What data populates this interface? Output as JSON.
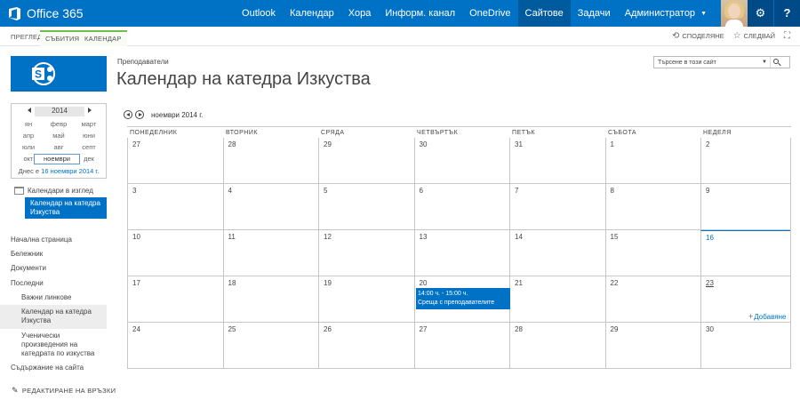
{
  "suite": {
    "brand": "Office 365",
    "nav": [
      {
        "label": "Outlook"
      },
      {
        "label": "Календар"
      },
      {
        "label": "Хора"
      },
      {
        "label": "Информ. канал"
      },
      {
        "label": "OneDrive"
      },
      {
        "label": "Сайтове",
        "active": true
      },
      {
        "label": "Задачи"
      },
      {
        "label": "Администратор",
        "dropdown": true
      }
    ],
    "help_label": "?"
  },
  "ribbon": {
    "tabs": [
      "ПРЕГЛЕД",
      "СЪБИТИЯ",
      "КАЛЕНДАР"
    ],
    "share_label": "СПОДЕЛЯНЕ",
    "follow_label": "СЛЕДВАЙ"
  },
  "datepicker": {
    "year": "2014",
    "months": [
      "ян",
      "февр",
      "март",
      "апр",
      "май",
      "юни",
      "юли",
      "авг",
      "септ",
      "окт",
      "ноември",
      "дек"
    ],
    "selected_month": "ноември",
    "today_prefix": "Днес е ",
    "today_link": "16 ноември 2014 г."
  },
  "calendars_in_view": {
    "header": "Календари в изглед",
    "item": "Календар на катедра Изкуства"
  },
  "quicknav": {
    "home": "Начална страница",
    "notebook": "Бележник",
    "documents": "Документи",
    "recent": "Последни",
    "recent_items": [
      "Важни линкове",
      "Календар на катедра Изкуства",
      "Ученически произведения на катедрата по изкуства"
    ],
    "site_contents": "Съдържание на сайта",
    "edit_links": "РЕДАКТИРАНЕ НА ВРЪЗКИ"
  },
  "header": {
    "breadcrumb": "Преподаватели",
    "title": "Календар на катедра Изкуства",
    "search_placeholder": "Търсене в този сайт"
  },
  "calendar": {
    "month_label": "ноември 2014 г.",
    "weekdays": [
      "ПОНЕДЕЛНИК",
      "ВТОРНИК",
      "СРЯДА",
      "ЧЕТВЪРТЪК",
      "ПЕТЪК",
      "СЪБОТА",
      "НЕДЕЛЯ"
    ],
    "weeks": [
      [
        "27",
        "28",
        "29",
        "30",
        "31",
        "1",
        "2"
      ],
      [
        "3",
        "4",
        "5",
        "6",
        "7",
        "8",
        "9"
      ],
      [
        "10",
        "11",
        "12",
        "13",
        "14",
        "15",
        "16"
      ],
      [
        "17",
        "18",
        "19",
        "20",
        "21",
        "22",
        "23"
      ],
      [
        "24",
        "25",
        "26",
        "27",
        "28",
        "29",
        "30"
      ]
    ],
    "today": "16",
    "event": {
      "time": "14:00 ч. - 15:00 ч.",
      "title": "Среща с преподавателите"
    },
    "add_label": "Добавяне"
  },
  "colors": {
    "accent": "#0072c6",
    "ribbon_context": "#6fbe4a"
  }
}
